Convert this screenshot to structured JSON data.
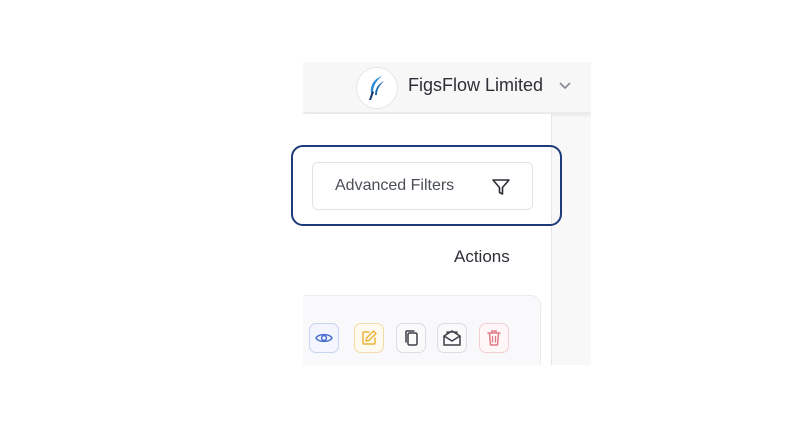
{
  "header": {
    "company_name": "FigsFlow Limited",
    "logo_icon": "figsflow-feather-logo",
    "dropdown_icon": "chevron-down-icon"
  },
  "filters": {
    "advanced_label": "Advanced Filters",
    "icon": "filter-funnel-icon"
  },
  "table": {
    "actions_header": "Actions",
    "row_actions": [
      "view",
      "edit",
      "duplicate",
      "email",
      "delete"
    ]
  },
  "colors": {
    "focus_ring": "#1d3a7a",
    "view_icon": "#4a6fd1",
    "edit_icon": "#e9b53b",
    "delete_icon": "#e27a86",
    "neutral_icon": "#3d4048"
  }
}
